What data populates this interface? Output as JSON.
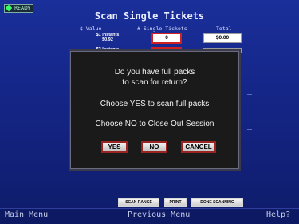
{
  "status": {
    "ready": "READY"
  },
  "screen": {
    "title": "Scan Single Tickets",
    "columns": [
      "$ Value",
      "# Single Tickets",
      "Total"
    ],
    "rows": [
      {
        "label_line1": "$1 Instants",
        "label_line2": "$0.92",
        "count": "0",
        "total": "$0.00"
      },
      {
        "label_line1": "$2 Instants",
        "label_line2": "",
        "count": "",
        "total": ""
      }
    ]
  },
  "dialog": {
    "line1": "Do you have full packs",
    "line2": "to scan for return?",
    "line3": "Choose YES to scan full packs",
    "line4": "Choose NO to Close Out Session",
    "buttons": {
      "yes": "YES",
      "no": "NO",
      "cancel": "CANCEL"
    }
  },
  "actions": {
    "scan_range": "SCAN RANGE",
    "print": "PRINT",
    "done_scanning": "DONE SCANNING"
  },
  "bottom": {
    "left": "Main Menu",
    "center": "Previous Menu",
    "right": "Help?"
  },
  "colors": {
    "background": "#142586",
    "dialog": "#1a1a1a",
    "button_border": "#9a2424",
    "input_border": "#d02020"
  }
}
